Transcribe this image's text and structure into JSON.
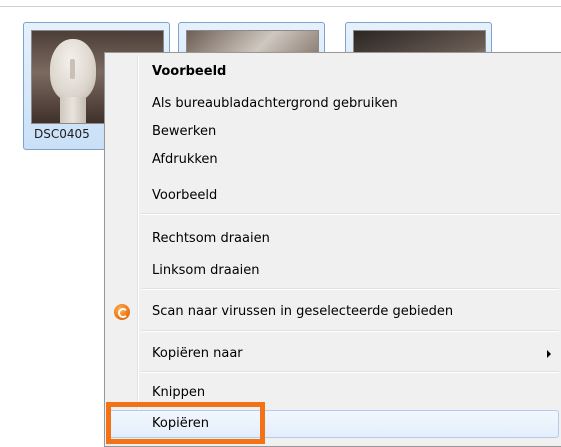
{
  "thumbnails": [
    {
      "label": "DSC0405"
    },
    {
      "label": ""
    },
    {
      "label": ""
    }
  ],
  "context_menu": {
    "items": {
      "preview_default": "Voorbeeld",
      "set_as_desktop_background": "Als bureaubladachtergrond gebruiken",
      "edit": "Bewerken",
      "print": "Afdrukken",
      "preview": "Voorbeeld",
      "rotate_clockwise": "Rechtsom draaien",
      "rotate_counterclockwise": "Linksom draaien",
      "scan_for_viruses": "Scan naar virussen in geselecteerde gebieden",
      "copy_to": "Kopiëren naar",
      "cut": "Knippen",
      "copy": "Kopiëren"
    },
    "hovered_item": "copy",
    "accent_color": "#f47216",
    "hover_color": "#e3eefb",
    "scan_icon": "avast-icon"
  }
}
